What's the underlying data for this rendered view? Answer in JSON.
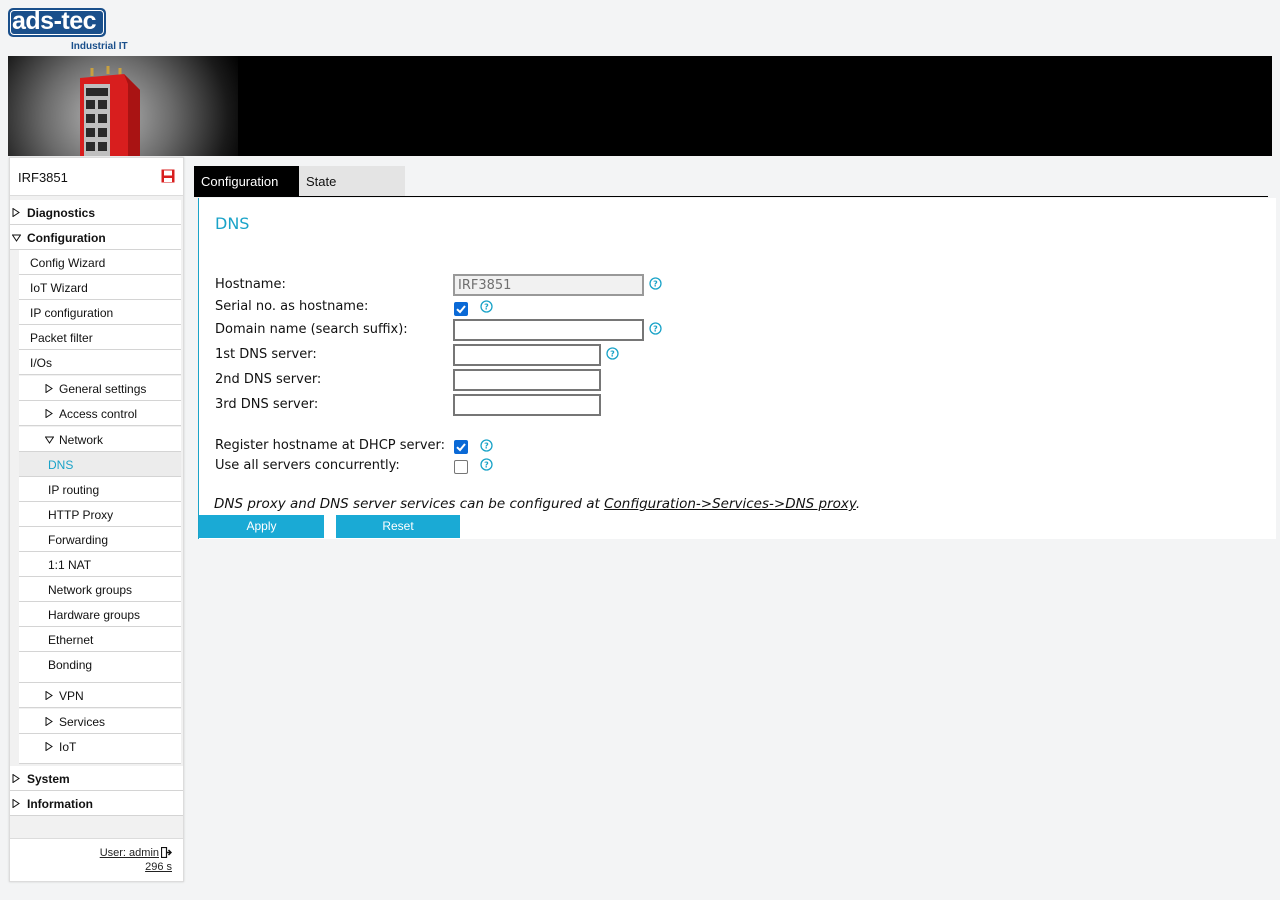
{
  "brand": {
    "logo_text": "ads-tec",
    "tagline": "Industrial IT"
  },
  "sidebar": {
    "device_name": "IRF3851",
    "items": [
      {
        "label": "Diagnostics"
      },
      {
        "label": "Configuration"
      },
      {
        "label": "Config Wizard"
      },
      {
        "label": "IoT Wizard"
      },
      {
        "label": "IP configuration"
      },
      {
        "label": "Packet filter"
      },
      {
        "label": "I/Os"
      },
      {
        "label": "General settings"
      },
      {
        "label": "Access control"
      },
      {
        "label": "Network"
      },
      {
        "label": "DNS"
      },
      {
        "label": "IP routing"
      },
      {
        "label": "HTTP Proxy"
      },
      {
        "label": "Forwarding"
      },
      {
        "label": "1:1 NAT"
      },
      {
        "label": "Network groups"
      },
      {
        "label": "Hardware groups"
      },
      {
        "label": "Ethernet"
      },
      {
        "label": "Bonding"
      },
      {
        "label": "VPN"
      },
      {
        "label": "Services"
      },
      {
        "label": "IoT"
      },
      {
        "label": "System"
      },
      {
        "label": "Information"
      }
    ],
    "user": "User: admin",
    "session": "296 s"
  },
  "tabs": [
    {
      "label": "Configuration"
    },
    {
      "label": "State"
    }
  ],
  "dns": {
    "title": "DNS",
    "hostname": {
      "label": "Hostname:",
      "value": "IRF3851"
    },
    "serial_hostname": {
      "label": "Serial no. as hostname:",
      "checked": true
    },
    "domain": {
      "label": "Domain name (search suffix):",
      "value": ""
    },
    "dns1": {
      "label": "1st DNS server:",
      "value": ""
    },
    "dns2": {
      "label": "2nd DNS server:",
      "value": ""
    },
    "dns3": {
      "label": "3rd DNS server:",
      "value": ""
    },
    "register": {
      "label": "Register hostname at DHCP server:",
      "checked": true
    },
    "concurrent": {
      "label": "Use all servers concurrently:",
      "checked": false
    },
    "note_prefix": "DNS proxy and DNS server services can be configured at ",
    "note_link": "Configuration->Services->DNS proxy",
    "note_suffix": ".",
    "apply_label": "Apply",
    "reset_label": "Reset"
  },
  "colors": {
    "accent": "#1aa3c8",
    "brand_blue": "#1a4f8b",
    "checkbox_blue": "#0a69d6",
    "device_red": "#d81e1e"
  }
}
